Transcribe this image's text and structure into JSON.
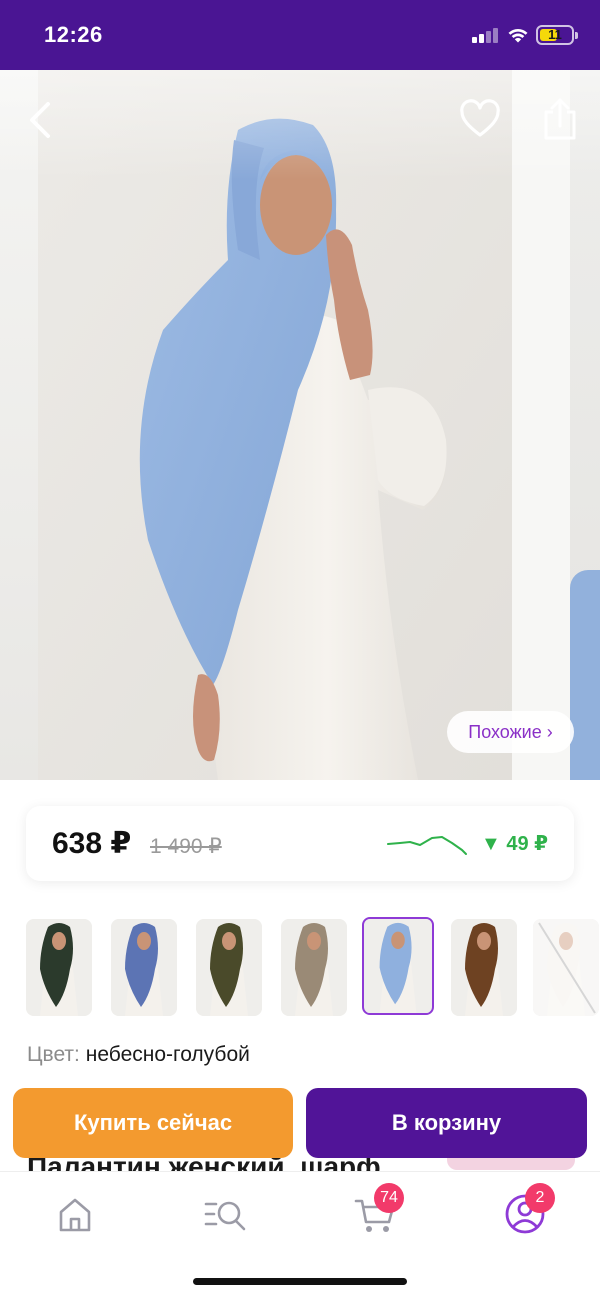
{
  "status_bar": {
    "time": "12:26",
    "battery_percent": "11"
  },
  "gallery": {
    "similar_label": "Похожие ›"
  },
  "price": {
    "current": "638 ₽",
    "old": "1 490 ₽",
    "drop": "▼ 49 ₽"
  },
  "colors": {
    "accent": "#511498",
    "status_bar": "#4a1593",
    "buy_now": "#f39a2f",
    "price_drop": "#2fb24b",
    "badge": "#f23a6a",
    "similar_text": "#8a2fc7"
  },
  "thumbnails": [
    {
      "name": "scarf-dark-green",
      "scarf_color": "#2b3a2c",
      "selected": false
    },
    {
      "name": "scarf-blue",
      "scarf_color": "#5c74b4",
      "selected": false
    },
    {
      "name": "scarf-khaki",
      "scarf_color": "#4a4a2a",
      "selected": false
    },
    {
      "name": "scarf-taupe",
      "scarf_color": "#9a8a76",
      "selected": false
    },
    {
      "name": "scarf-sky-blue",
      "scarf_color": "#8fb0de",
      "selected": true
    },
    {
      "name": "scarf-brown",
      "scarf_color": "#6e4222",
      "selected": false
    },
    {
      "name": "scarf-white",
      "scarf_color": "#f1ede7",
      "selected": false,
      "unavailable": true
    }
  ],
  "product": {
    "color_label": "Цвет:",
    "color_value": "небесно-голубой",
    "title": "Палантин женский, шарф"
  },
  "actions": {
    "buy_now": "Купить сейчас",
    "add_to_cart": "В корзину"
  },
  "tab_bar": {
    "items": [
      {
        "name": "home",
        "icon": "home-icon"
      },
      {
        "name": "catalog",
        "icon": "catalog-search-icon"
      },
      {
        "name": "cart",
        "icon": "cart-icon",
        "badge": "74"
      },
      {
        "name": "profile",
        "icon": "profile-icon",
        "badge": "2"
      }
    ]
  }
}
